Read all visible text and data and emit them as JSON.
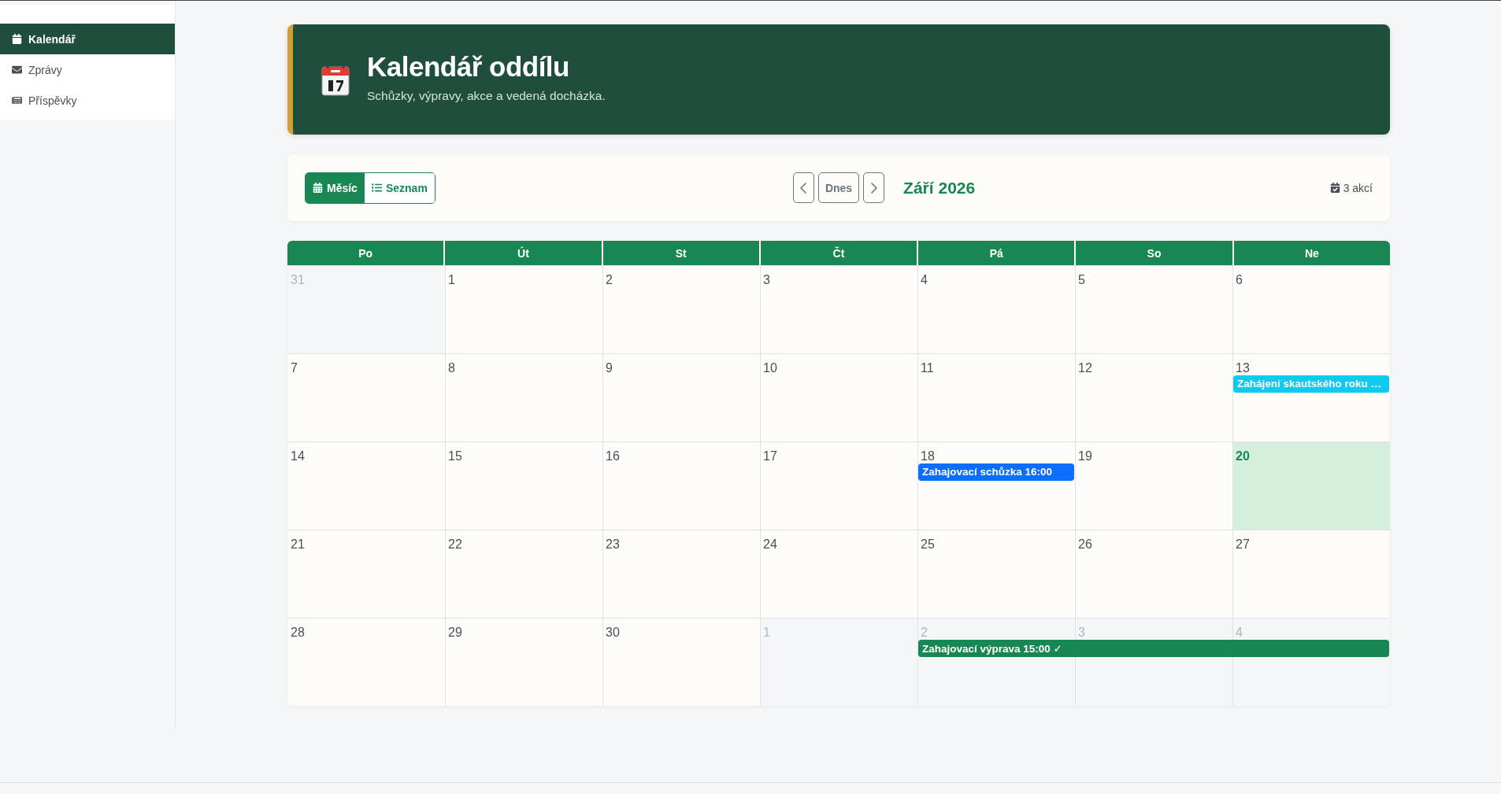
{
  "sidebar": {
    "items": [
      {
        "label": "Kalendář",
        "selected": true
      },
      {
        "label": "Zprávy",
        "selected": false
      },
      {
        "label": "Příspěvky",
        "selected": false
      }
    ]
  },
  "header": {
    "title": "Kalendář oddílu",
    "subtitle": "Schůzky, výpravy, akce a vedená docházka."
  },
  "toolbar": {
    "views": [
      {
        "label": "Měsíc",
        "selected": true
      },
      {
        "label": "Seznam",
        "selected": false
      }
    ],
    "today_button": "Dnes",
    "month": "Září 2026",
    "count": "3 akcí"
  },
  "calendar": {
    "weekdays": [
      "Po",
      "Út",
      "St",
      "Čt",
      "Pá",
      "So",
      "Ne"
    ],
    "weeks": [
      [
        {
          "day": "31",
          "other_month": true
        },
        {
          "day": "1"
        },
        {
          "day": "2"
        },
        {
          "day": "3"
        },
        {
          "day": "4"
        },
        {
          "day": "5"
        },
        {
          "day": "6"
        }
      ],
      [
        {
          "day": "7"
        },
        {
          "day": "8"
        },
        {
          "day": "9"
        },
        {
          "day": "10"
        },
        {
          "day": "11"
        },
        {
          "day": "12"
        },
        {
          "day": "13",
          "events": [
            {
              "title": "Zahájení skautského roku …",
              "color": "#0dcaf0"
            }
          ]
        }
      ],
      [
        {
          "day": "14"
        },
        {
          "day": "15"
        },
        {
          "day": "16"
        },
        {
          "day": "17"
        },
        {
          "day": "18",
          "events": [
            {
              "title": "Zahajovací schůzka 16:00",
              "color": "#0d6efd"
            }
          ]
        },
        {
          "day": "19"
        },
        {
          "day": "20",
          "today": true
        }
      ],
      [
        {
          "day": "21"
        },
        {
          "day": "22"
        },
        {
          "day": "23"
        },
        {
          "day": "24"
        },
        {
          "day": "25"
        },
        {
          "day": "26"
        },
        {
          "day": "27"
        }
      ],
      [
        {
          "day": "28"
        },
        {
          "day": "29"
        },
        {
          "day": "30"
        },
        {
          "day": "1",
          "other_month": true
        },
        {
          "day": "2",
          "other_month": true,
          "events": [
            {
              "title": "Zahajovací výprava 15:00 ✓",
              "color": "#198754"
            }
          ]
        },
        {
          "day": "3",
          "other_month": true,
          "covered": true
        },
        {
          "day": "4",
          "other_month": true,
          "covered": true
        }
      ]
    ]
  }
}
